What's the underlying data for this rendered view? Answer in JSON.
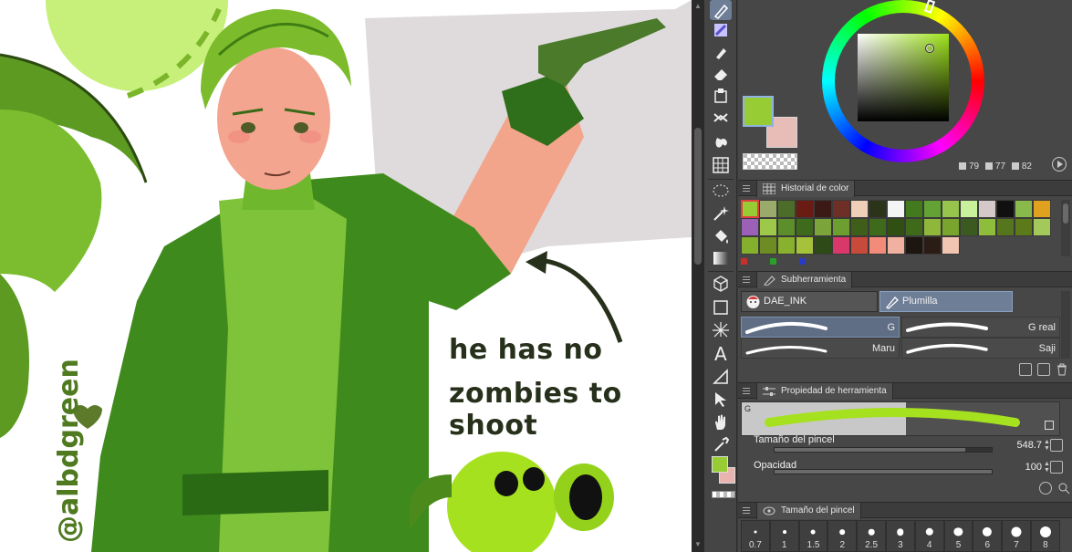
{
  "canvas": {
    "caption_line1": "he has no",
    "caption_line2": "zombies to shoot",
    "signature": "@albdgreen"
  },
  "color_panel": {
    "main_color": "#98cc35",
    "sub_color": "#e8bcb7",
    "hsv": {
      "h": "79",
      "s": "77",
      "v": "82"
    }
  },
  "color_history": {
    "title": "Historial de color",
    "swatches": [
      "#98cc35",
      "#9aaa6a",
      "#4c6d2a",
      "#6a1b12",
      "#3b1a15",
      "#6d2f26",
      "#f0cfb8",
      "#2b3318",
      "#f4f4f4",
      "#437a1e",
      "#63a335",
      "#96c44d",
      "#c9f09a",
      "#d4c8c8",
      "#101010",
      "#88b94a",
      "#e0a21e",
      "#9a61b6",
      "#9ec84a",
      "#5c8f2c",
      "#3e6a1c",
      "#7ba43a",
      "#6d9f30",
      "#3e5e1a",
      "#3e6a1c",
      "#2f5012",
      "#3f6a1a",
      "#8fb83a",
      "#79a42e",
      "#3b5a20",
      "#8ebd3b",
      "#56761e",
      "#5c7a1a",
      "#a2c95a",
      "#84b02e",
      "#6d8c24",
      "#88b22e",
      "#a4c23a",
      "#2e4a16",
      "#d9386a",
      "#c84a3a",
      "#f28b7a",
      "#f0b1a1",
      "#1d1510",
      "#2b1d16",
      "#f2c4b2"
    ]
  },
  "subtool": {
    "title": "Subherramienta",
    "group1": "DAE_INK",
    "group2": "Plumilla",
    "brushes": [
      "G",
      "G real",
      "Maru",
      "Saji"
    ]
  },
  "tool_property": {
    "title": "Propiedad de herramienta",
    "preview_label": "G",
    "brush_size_label": "Tamaño del pincel",
    "brush_size_value": "548.7",
    "opacity_label": "Opacidad",
    "opacity_value": "100",
    "brush_size_fraction": 0.88,
    "opacity_fraction": 1.0
  },
  "brush_size": {
    "title": "Tamaño del pincel",
    "sizes": [
      "0.7",
      "1",
      "1.5",
      "2",
      "2.5",
      "3",
      "4",
      "5",
      "6",
      "7",
      "8"
    ]
  },
  "icons": {
    "toolbar": [
      "pen-icon",
      "brush-icon",
      "airbrush-icon",
      "eraser-icon",
      "decoration-icon",
      "figure-icon",
      "fill-icon",
      "grid-icon",
      "lasso-icon",
      "magic-wand-icon",
      "fill-bucket-icon",
      "gradient-icon",
      "3d-icon",
      "rectangle-icon",
      "border-icon",
      "text-icon",
      "ruler-icon",
      "select-arrow-icon",
      "hand-icon",
      "eyedropper-icon"
    ]
  }
}
